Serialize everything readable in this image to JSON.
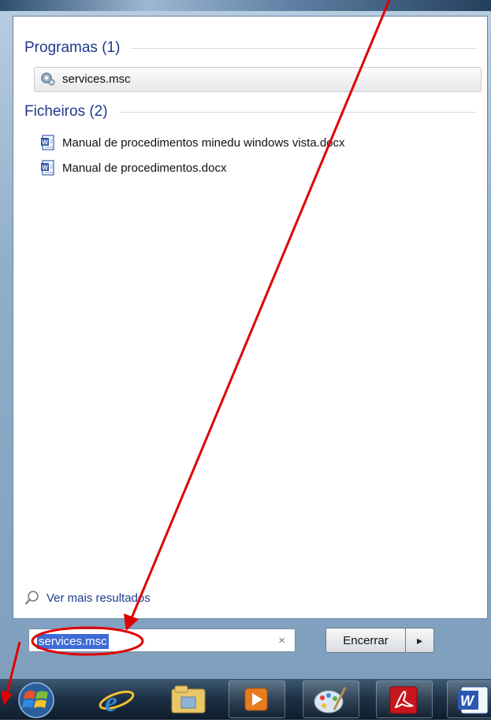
{
  "search_panel": {
    "groups": [
      {
        "header": "Programas (1)",
        "items": [
          {
            "label": "services.msc",
            "icon": "gear-icon"
          }
        ]
      },
      {
        "header": "Ficheiros (2)",
        "items": [
          {
            "label": "Manual de procedimentos minedu windows vista.docx",
            "icon": "word-doc-icon"
          },
          {
            "label": "Manual de procedimentos.docx",
            "icon": "word-doc-icon"
          }
        ]
      }
    ],
    "more_results": "Ver mais resultados"
  },
  "search_bar": {
    "value": "services.msc",
    "clear_icon": "×",
    "shutdown_label": "Encerrar",
    "shutdown_arrow": "▸"
  },
  "taskbar": {
    "items": [
      {
        "icon": "windows-start-orb-icon"
      },
      {
        "icon": "internet-explorer-icon"
      },
      {
        "icon": "file-explorer-icon"
      },
      {
        "icon": "media-player-icon"
      },
      {
        "icon": "paint-icon"
      },
      {
        "icon": "adobe-reader-icon"
      },
      {
        "icon": "word-icon"
      }
    ]
  },
  "annotation": {
    "arrow_color": "#e00000",
    "ellipse_color": "#e00000"
  }
}
